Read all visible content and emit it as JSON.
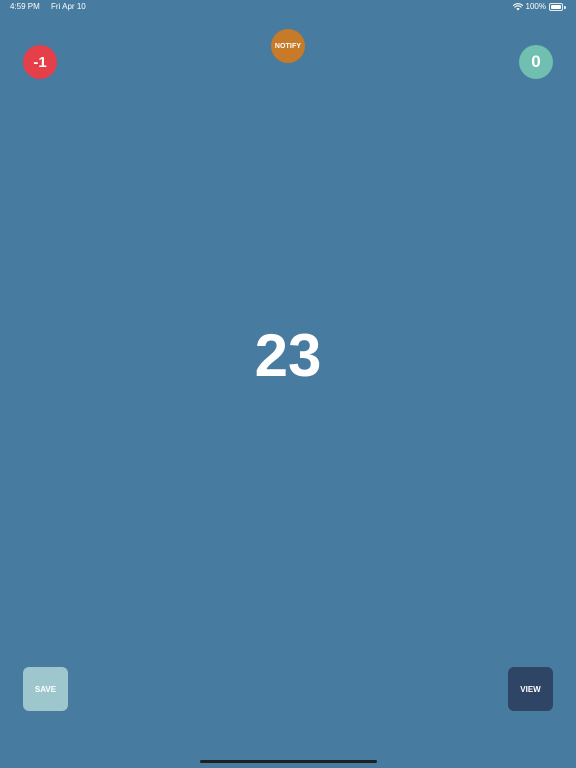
{
  "status_bar": {
    "time": "4:59 PM",
    "date": "Fri Apr 10",
    "battery": "100%",
    "battery_level": 1.0,
    "wifi_icon": "wifi-icon",
    "battery_icon": "battery-icon"
  },
  "buttons": {
    "minus_label": "-1",
    "notify_label": "NOTIFY",
    "zero_label": "0",
    "save_label": "SAVE",
    "view_label": "VIEW"
  },
  "counter": {
    "value": "23"
  },
  "colors": {
    "background": "#477b9f",
    "minus": "#e5404a",
    "notify": "#c77a28",
    "zero": "#70bfb1",
    "save": "#9dc7cc",
    "view": "#2f4566"
  }
}
